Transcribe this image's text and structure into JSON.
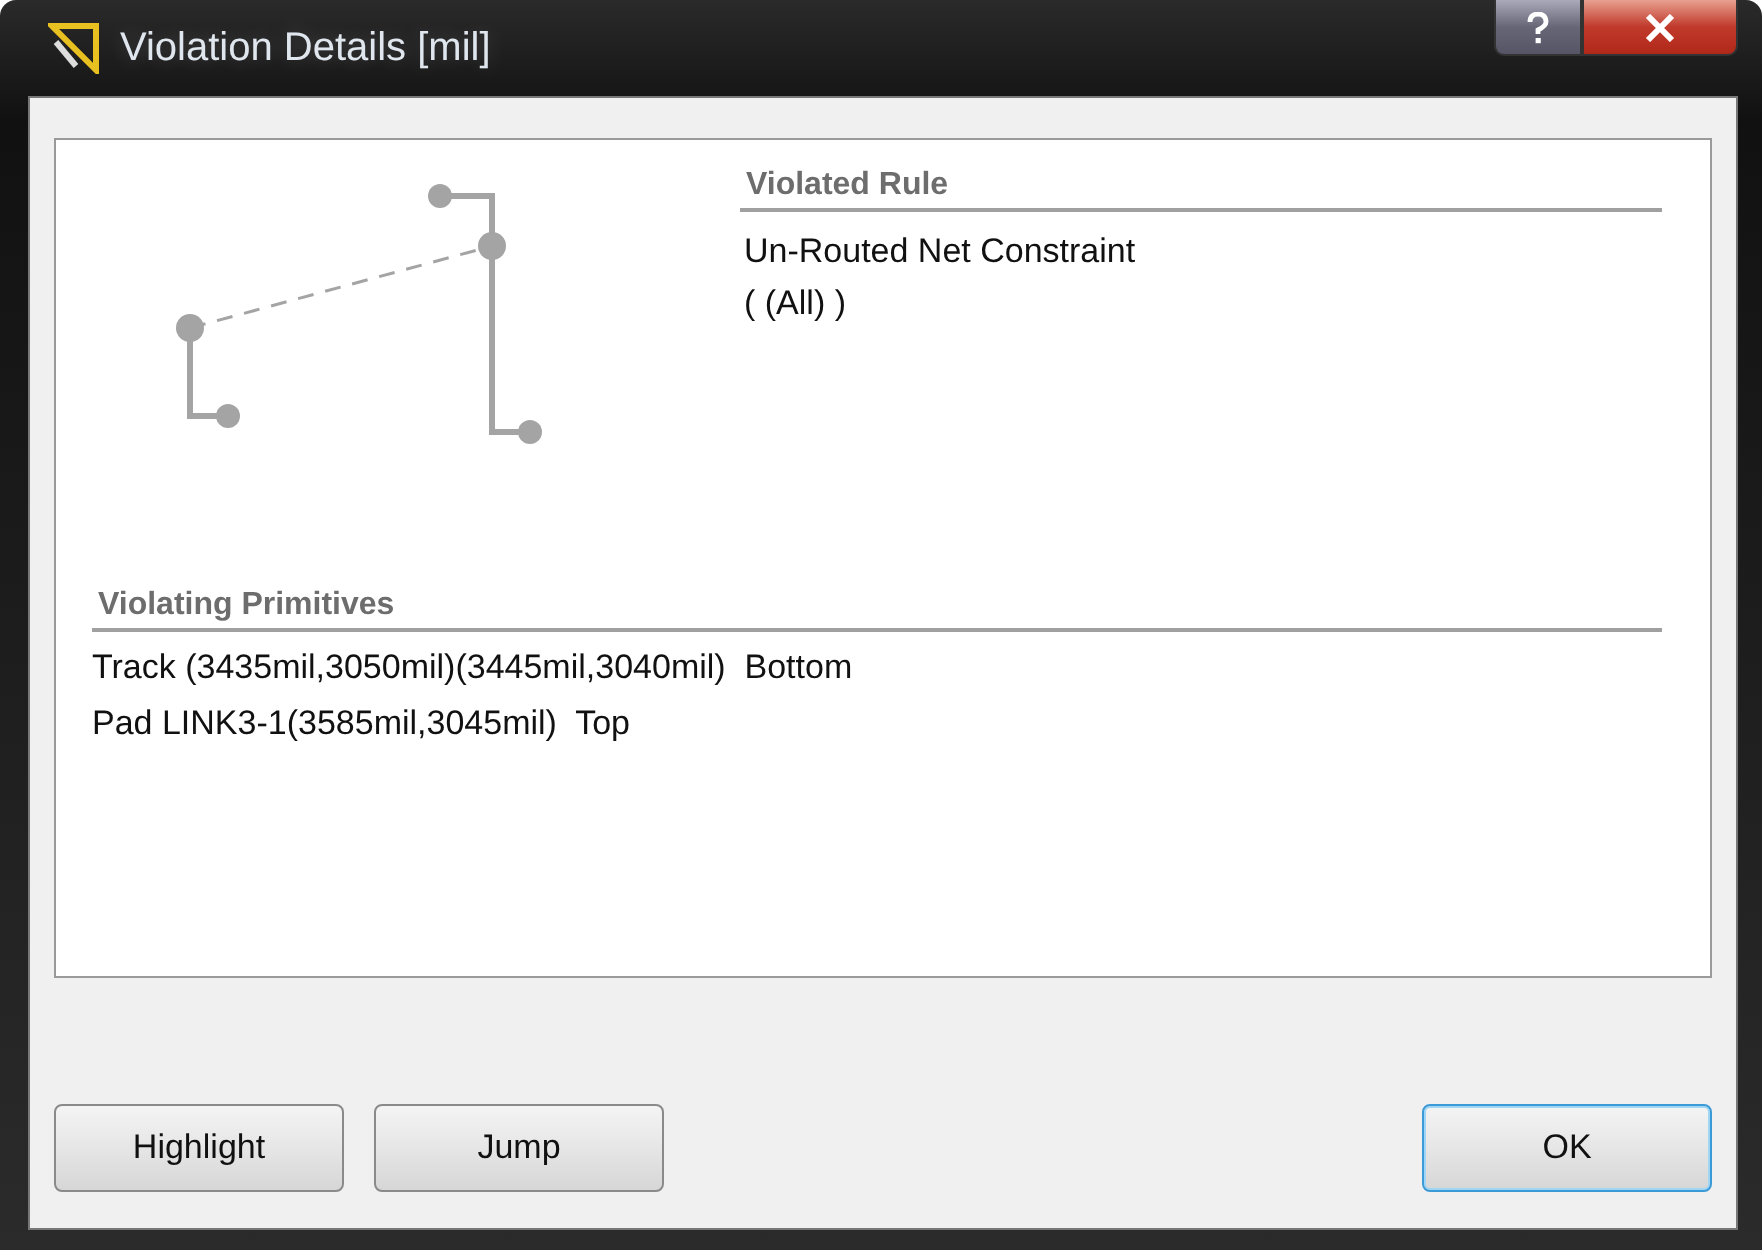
{
  "window": {
    "title": "Violation Details [mil]"
  },
  "violated_rule": {
    "heading": "Violated Rule",
    "lines": [
      "Un-Routed Net Constraint",
      "( (All) )"
    ]
  },
  "violating_primitives": {
    "heading": "Violating Primitives",
    "items": [
      "Track (3435mil,3050mil)(3445mil,3040mil)  Bottom",
      "Pad LINK3-1(3585mil,3045mil)  Top"
    ]
  },
  "buttons": [
    {
      "label": "Highlight",
      "default": false
    },
    {
      "label": "Jump",
      "default": false
    },
    {
      "label": "OK",
      "default": true
    }
  ]
}
